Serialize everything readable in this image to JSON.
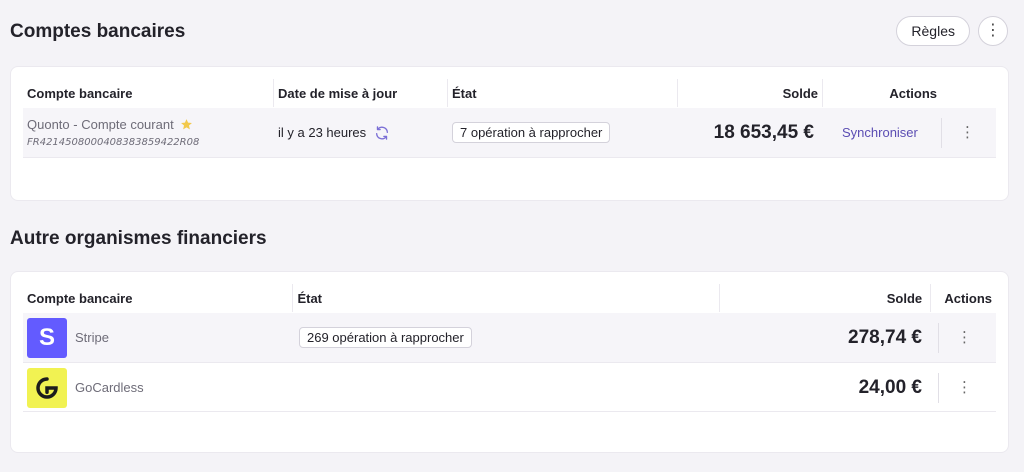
{
  "bank_section": {
    "title": "Comptes bancaires",
    "rules_label": "Règles",
    "more_label": "⋮",
    "columns": {
      "account": "Compte bancaire",
      "updated": "Date de mise à jour",
      "state": "État",
      "balance": "Solde",
      "actions": "Actions"
    },
    "rows": [
      {
        "name": "Quonto - Compte courant",
        "iban": "FR4214508000408383859422R08",
        "updated": "il y a 23 heures",
        "state": "7 opération à rapprocher",
        "balance": "18 653,45 €",
        "sync_label": "Synchroniser",
        "menu": "⋮"
      }
    ]
  },
  "other_section": {
    "title": "Autre organismes financiers",
    "columns": {
      "account": "Compte bancaire",
      "state": "État",
      "balance": "Solde",
      "actions": "Actions"
    },
    "rows": [
      {
        "name": "Stripe",
        "logo_letter": "S",
        "logo_color": "#635bff",
        "state": "269 opération à rapprocher",
        "balance": "278,74 €",
        "menu": "⋮"
      },
      {
        "name": "GoCardless",
        "logo_color": "#f1f252",
        "balance": "24,00 €",
        "menu": "⋮"
      }
    ]
  },
  "colors": {
    "accent": "#5b4db3",
    "star": "#f2c94c"
  }
}
